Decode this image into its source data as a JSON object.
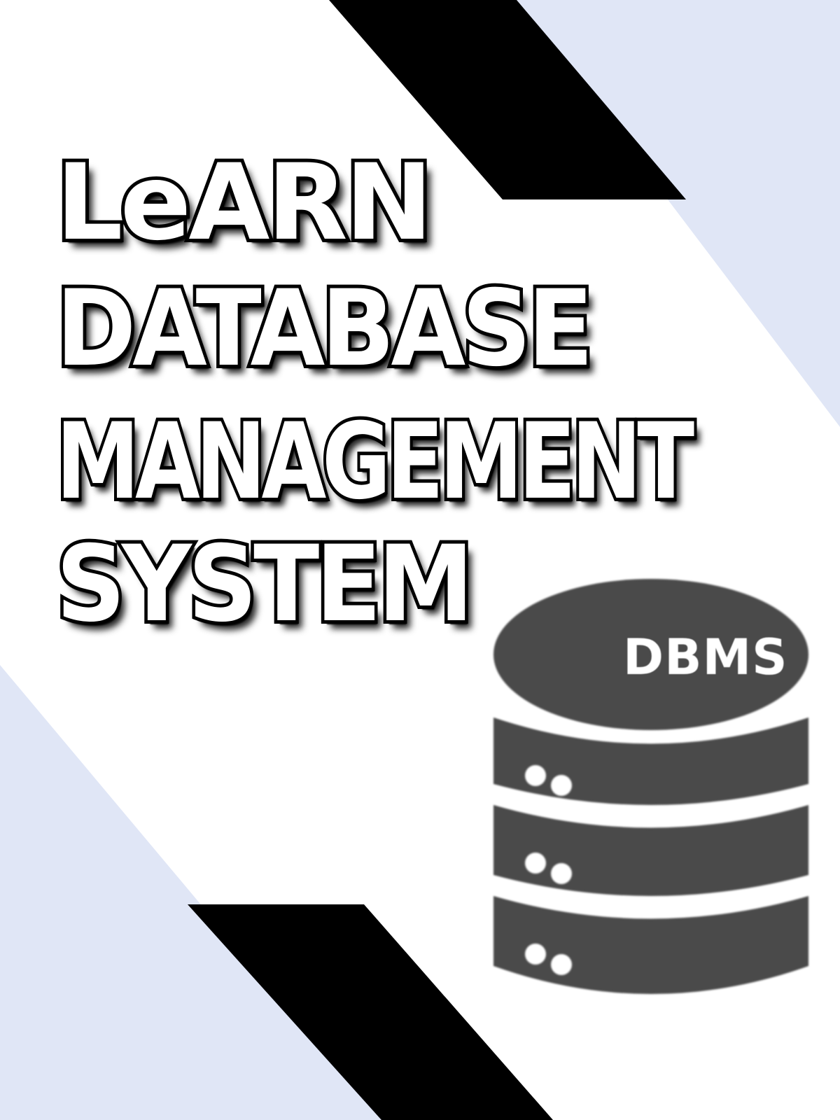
{
  "title_lines": [
    "LeARN",
    "DATABASE",
    "MANAGEMENT",
    "SYSTEM"
  ],
  "icon": {
    "name": "database-server-icon",
    "label": "DBMS"
  },
  "colors": {
    "background": "#ffffff",
    "accent_blue": "#e0e6f6",
    "stripe_black": "#000000",
    "icon_gray": "#4a4a4a"
  }
}
